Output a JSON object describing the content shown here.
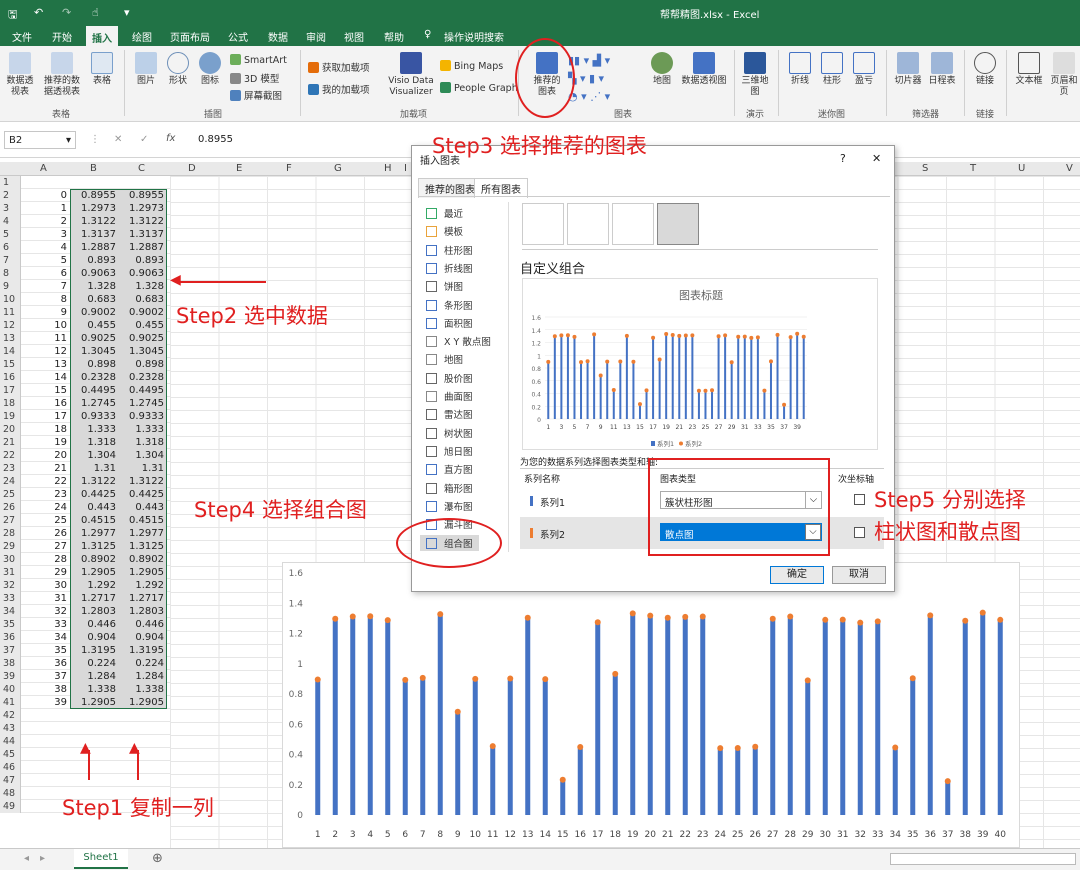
{
  "titlebar": {
    "filename": "帮帮精图.xlsx  -  Excel"
  },
  "menu": {
    "tabs": [
      "文件",
      "开始",
      "插入",
      "绘图",
      "页面布局",
      "公式",
      "数据",
      "审阅",
      "视图",
      "帮助",
      "操作说明搜索"
    ]
  },
  "ribbon": {
    "btn_pivot": "数据透视表",
    "btn_rec_pivot": "推荐的数据透视表",
    "btn_table": "表格",
    "btn_picture": "图片",
    "btn_shapes": "形状",
    "btn_icons": "图标",
    "btn_smartart": "SmartArt",
    "btn_3d": "3D 模型",
    "btn_screenshot": "屏幕截图",
    "btn_get_addins": "获取加载项",
    "btn_my_addins": "我的加载项",
    "btn_visio": "Visio Data Visualizer",
    "btn_bing": "Bing Maps",
    "btn_people": "People Graph",
    "btn_rec_chart": "推荐的图表",
    "btn_map": "地图",
    "btn_pivotchart": "数据透视图",
    "btn_3dmap": "三维地图",
    "btn_line": "折线",
    "btn_column": "柱形",
    "btn_winloss": "盈亏",
    "btn_slicer": "切片器",
    "btn_timeline": "日程表",
    "btn_link": "链接",
    "btn_textbox": "文本框",
    "btn_header": "页眉和页",
    "grp_tables": "表格",
    "grp_illus": "插图",
    "grp_addins": "加载项",
    "grp_charts": "图表",
    "grp_tours": "演示",
    "grp_spark": "迷你图",
    "grp_filters": "筛选器",
    "grp_links": "链接"
  },
  "formula": {
    "namebox": "B2",
    "fx": "fx",
    "value": "0.8955"
  },
  "columns": [
    "A",
    "B",
    "C",
    "D",
    "E",
    "F",
    "G",
    "H",
    "I",
    "S",
    "T",
    "U",
    "V"
  ],
  "rows": [
    [
      "0",
      "0.8955",
      "0.8955"
    ],
    [
      "1",
      "1.2973",
      "1.2973"
    ],
    [
      "2",
      "1.3122",
      "1.3122"
    ],
    [
      "3",
      "1.3137",
      "1.3137"
    ],
    [
      "4",
      "1.2887",
      "1.2887"
    ],
    [
      "5",
      "0.893",
      "0.893"
    ],
    [
      "6",
      "0.9063",
      "0.9063"
    ],
    [
      "7",
      "1.328",
      "1.328"
    ],
    [
      "8",
      "0.683",
      "0.683"
    ],
    [
      "9",
      "0.9002",
      "0.9002"
    ],
    [
      "10",
      "0.455",
      "0.455"
    ],
    [
      "11",
      "0.9025",
      "0.9025"
    ],
    [
      "12",
      "1.3045",
      "1.3045"
    ],
    [
      "13",
      "0.898",
      "0.898"
    ],
    [
      "14",
      "0.2328",
      "0.2328"
    ],
    [
      "15",
      "0.4495",
      "0.4495"
    ],
    [
      "16",
      "1.2745",
      "1.2745"
    ],
    [
      "17",
      "0.9333",
      "0.9333"
    ],
    [
      "18",
      "1.333",
      "1.333"
    ],
    [
      "19",
      "1.318",
      "1.318"
    ],
    [
      "20",
      "1.304",
      "1.304"
    ],
    [
      "21",
      "1.31",
      "1.31"
    ],
    [
      "22",
      "1.3122",
      "1.3122"
    ],
    [
      "23",
      "0.4425",
      "0.4425"
    ],
    [
      "24",
      "0.443",
      "0.443"
    ],
    [
      "25",
      "0.4515",
      "0.4515"
    ],
    [
      "26",
      "1.2977",
      "1.2977"
    ],
    [
      "27",
      "1.3125",
      "1.3125"
    ],
    [
      "28",
      "0.8902",
      "0.8902"
    ],
    [
      "29",
      "1.2905",
      "1.2905"
    ],
    [
      "30",
      "1.292",
      "1.292"
    ],
    [
      "31",
      "1.2717",
      "1.2717"
    ],
    [
      "32",
      "1.2803",
      "1.2803"
    ],
    [
      "33",
      "0.446",
      "0.446"
    ],
    [
      "34",
      "0.904",
      "0.904"
    ],
    [
      "35",
      "1.3195",
      "1.3195"
    ],
    [
      "36",
      "0.224",
      "0.224"
    ],
    [
      "37",
      "1.284",
      "1.284"
    ],
    [
      "38",
      "1.338",
      "1.338"
    ],
    [
      "39",
      "1.2905",
      "1.2905"
    ]
  ],
  "empty_rows": [
    "42",
    "43",
    "44",
    "45",
    "46",
    "47",
    "48",
    "49"
  ],
  "sheet": {
    "tab": "Sheet1"
  },
  "dialog": {
    "title": "插入图表",
    "help": "?",
    "close": "✕",
    "tab_recommended": "推荐的图表",
    "tab_all": "所有图表",
    "chart_types": [
      "最近",
      "模板",
      "柱形图",
      "折线图",
      "饼图",
      "条形图",
      "面积图",
      "X Y 散点图",
      "地图",
      "股价图",
      "曲面图",
      "雷达图",
      "树状图",
      "旭日图",
      "直方图",
      "箱形图",
      "瀑布图",
      "漏斗图",
      "组合图"
    ],
    "combo_heading": "自定义组合",
    "preview_title": "图表标题",
    "preview_legend1": "系列1",
    "preview_legend2": "系列2",
    "series_prompt": "为您的数据系列选择图表类型和轴:",
    "hdr_name": "系列名称",
    "hdr_type": "图表类型",
    "hdr_secondary": "次坐标轴",
    "series1": "系列1",
    "series1_type": "簇状柱形图",
    "series2": "系列2",
    "series2_type": "散点图",
    "ok": "确定",
    "cancel": "取消"
  },
  "annotations": {
    "step1": "Step1 复制一列",
    "step2": "Step2 选中数据",
    "step3": "Step3 选择推荐的图表",
    "step4": "Step4 选择组合图",
    "step5a": "Step5 分别选择",
    "step5b": "柱状图和散点图"
  },
  "colors": {
    "excel_green": "#217346",
    "bar_blue": "#4472c4",
    "dot_orange": "#ed7d31",
    "annotation_red": "#e02020",
    "selection_blue": "#0078d7"
  },
  "chart_data": [
    {
      "type": "bar",
      "title": "",
      "x": [
        1,
        2,
        3,
        4,
        5,
        6,
        7,
        8,
        9,
        10,
        11,
        12,
        13,
        14,
        15,
        16,
        17,
        18,
        19,
        20,
        21,
        22,
        23,
        24,
        25,
        26,
        27,
        28,
        29,
        30,
        31,
        32,
        33,
        34,
        35,
        36,
        37,
        38,
        39,
        40
      ],
      "series": [
        {
          "type": "bar",
          "values": [
            0.8955,
            1.2973,
            1.3122,
            1.3137,
            1.2887,
            0.893,
            0.9063,
            1.328,
            0.683,
            0.9002,
            0.455,
            0.9025,
            1.3045,
            0.898,
            0.2328,
            0.4495,
            1.2745,
            0.9333,
            1.333,
            1.318,
            1.304,
            1.31,
            1.3122,
            0.4425,
            0.443,
            0.4515,
            1.2977,
            1.3125,
            0.8902,
            1.2905,
            1.292,
            1.2717,
            1.2803,
            0.446,
            0.904,
            1.3195,
            0.224,
            1.284,
            1.338,
            1.2905
          ]
        },
        {
          "type": "scatter",
          "values": [
            0.8955,
            1.2973,
            1.3122,
            1.3137,
            1.2887,
            0.893,
            0.9063,
            1.328,
            0.683,
            0.9002,
            0.455,
            0.9025,
            1.3045,
            0.898,
            0.2328,
            0.4495,
            1.2745,
            0.9333,
            1.333,
            1.318,
            1.304,
            1.31,
            1.3122,
            0.4425,
            0.443,
            0.4515,
            1.2977,
            1.3125,
            0.8902,
            1.2905,
            1.292,
            1.2717,
            1.2803,
            0.446,
            0.904,
            1.3195,
            0.224,
            1.284,
            1.338,
            1.2905
          ]
        }
      ],
      "yticks": [
        "0",
        "0.2",
        "0.4",
        "0.6",
        "0.8",
        "1",
        "1.2",
        "1.4",
        "1.6"
      ],
      "ylim": [
        0,
        1.6
      ],
      "grid": false
    },
    {
      "type": "bar",
      "title": "图表标题",
      "x": [
        1,
        2,
        3,
        4,
        5,
        6,
        7,
        8,
        9,
        10,
        11,
        12,
        13,
        14,
        15,
        16,
        17,
        18,
        19,
        20,
        21,
        22,
        23,
        24,
        25,
        26,
        27,
        28,
        29,
        30,
        31,
        32,
        33,
        34,
        35,
        36,
        37,
        38,
        39,
        40
      ],
      "xticks": [
        "1",
        "3",
        "5",
        "7",
        "9",
        "11",
        "13",
        "15",
        "17",
        "19",
        "21",
        "23",
        "25",
        "27",
        "29",
        "31",
        "33",
        "35",
        "37",
        "39"
      ],
      "series": [
        {
          "name": "系列1",
          "type": "bar",
          "values": [
            0.8955,
            1.2973,
            1.3122,
            1.3137,
            1.2887,
            0.893,
            0.9063,
            1.328,
            0.683,
            0.9002,
            0.455,
            0.9025,
            1.3045,
            0.898,
            0.2328,
            0.4495,
            1.2745,
            0.9333,
            1.333,
            1.318,
            1.304,
            1.31,
            1.3122,
            0.4425,
            0.443,
            0.4515,
            1.2977,
            1.3125,
            0.8902,
            1.2905,
            1.292,
            1.2717,
            1.2803,
            0.446,
            0.904,
            1.3195,
            0.224,
            1.284,
            1.338,
            1.2905
          ]
        },
        {
          "name": "系列2",
          "type": "scatter",
          "values": [
            0.8955,
            1.2973,
            1.3122,
            1.3137,
            1.2887,
            0.893,
            0.9063,
            1.328,
            0.683,
            0.9002,
            0.455,
            0.9025,
            1.3045,
            0.898,
            0.2328,
            0.4495,
            1.2745,
            0.9333,
            1.333,
            1.318,
            1.304,
            1.31,
            1.3122,
            0.4425,
            0.443,
            0.4515,
            1.2977,
            1.3125,
            0.8902,
            1.2905,
            1.292,
            1.2717,
            1.2803,
            0.446,
            0.904,
            1.3195,
            0.224,
            1.284,
            1.338,
            1.2905
          ]
        }
      ],
      "yticks": [
        "0",
        "0.2",
        "0.4",
        "0.6",
        "0.8",
        "1",
        "1.2",
        "1.4",
        "1.6"
      ],
      "ylim": [
        0,
        1.6
      ],
      "legend": "bottom"
    }
  ]
}
